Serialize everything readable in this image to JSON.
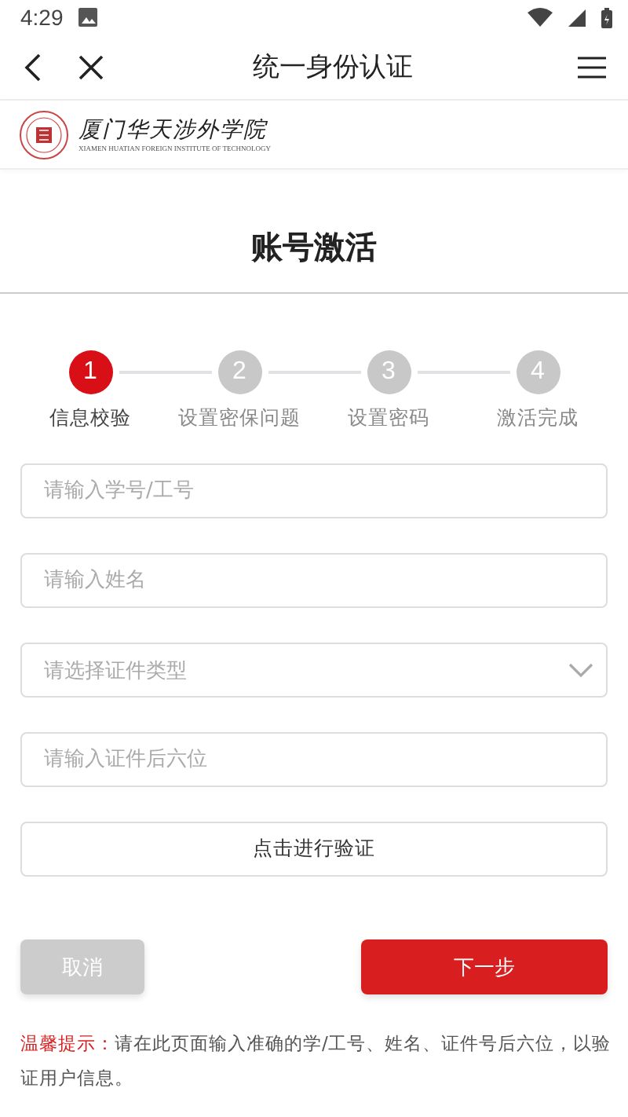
{
  "status_bar": {
    "time": "4:29"
  },
  "nav_bar": {
    "title": "统一身份认证"
  },
  "brand": {
    "name": "厦门华天涉外学院",
    "subtitle": "XIAMEN HUATIAN FOREIGN INSTITUTE OF TECHNOLOGY"
  },
  "page_title": "账号激活",
  "steps": [
    {
      "number": "1",
      "label": "信息校验",
      "selected": true
    },
    {
      "number": "2",
      "label": "设置密保问题",
      "selected": false
    },
    {
      "number": "3",
      "label": "设置密码",
      "selected": false
    },
    {
      "number": "4",
      "label": "激活完成",
      "selected": false
    }
  ],
  "fields": [
    {
      "kind": "input",
      "placeholder": "请输入学号/工号"
    },
    {
      "kind": "input",
      "placeholder": "请输入姓名"
    },
    {
      "kind": "select",
      "placeholder": "请选择证件类型"
    },
    {
      "kind": "input",
      "placeholder": "请输入证件后六位"
    }
  ],
  "verify_button": "点击进行验证",
  "buttons": [
    {
      "kind": "secondary",
      "label": "取消"
    },
    {
      "kind": "primary",
      "label": "下一步"
    }
  ],
  "tip": {
    "label": "温馨提示：",
    "text": "请在此页面输入准确的学/工号、姓名、证件号后六位，以验证用户信息。"
  }
}
